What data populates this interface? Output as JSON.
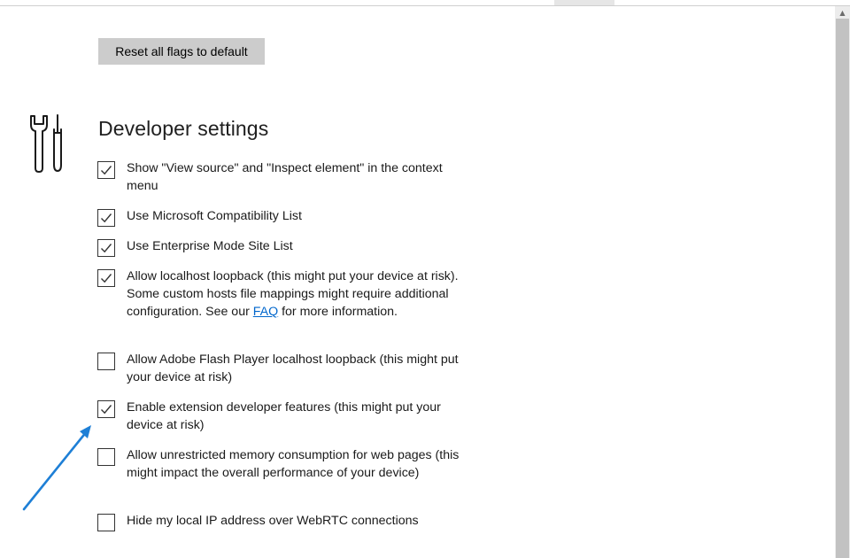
{
  "toolbar": {
    "reset_label": "Reset all flags to default"
  },
  "section": {
    "title": "Developer settings",
    "icon": "tools-icon"
  },
  "options": [
    {
      "label": "Show \"View source\" and \"Inspect element\" in the context menu",
      "checked": true
    },
    {
      "label": "Use Microsoft Compatibility List",
      "checked": true
    },
    {
      "label": "Use Enterprise Mode Site List",
      "checked": true
    },
    {
      "label_before_link": "Allow localhost loopback (this might put your device at risk). Some custom hosts file mappings might require additional configuration. See our ",
      "link_text": "FAQ",
      "label_after_link": " for more information.",
      "checked": true
    },
    {
      "label": "Allow Adobe Flash Player localhost loopback (this might put your device at risk)",
      "checked": false
    },
    {
      "label": "Enable extension developer features (this might put your device at risk)",
      "checked": true
    },
    {
      "label": "Allow unrestricted memory consumption for web pages (this might impact the overall performance of your device)",
      "checked": false
    },
    {
      "label": "Hide my local IP address over WebRTC connections",
      "checked": false
    }
  ],
  "colors": {
    "link": "#0066cc",
    "button_bg": "#cccccc",
    "annotation_arrow": "#1e7fd6",
    "scrollbar_track": "#ececec",
    "scrollbar_thumb": "#c2c2c2"
  }
}
